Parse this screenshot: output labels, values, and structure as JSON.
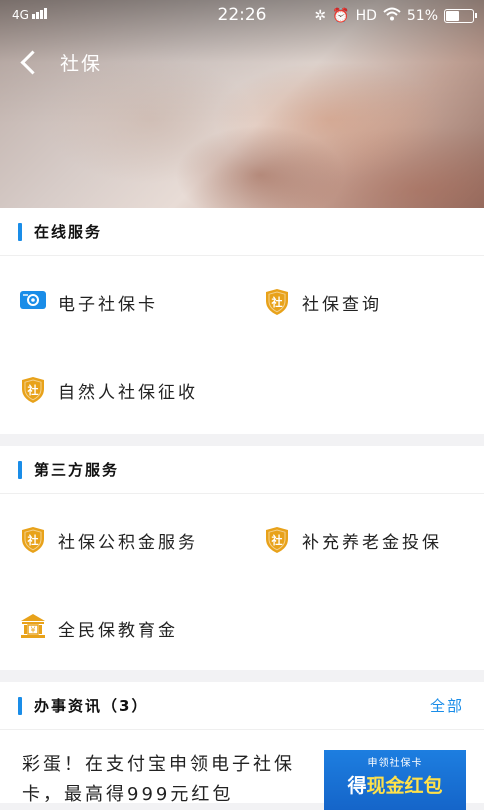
{
  "status": {
    "network": "4G",
    "time": "22:26",
    "hd": "HD",
    "battery": "51%",
    "battery_level": 0.51
  },
  "nav": {
    "title": "社保"
  },
  "online": {
    "title": "在线服务",
    "items": [
      {
        "label": "电子社保卡",
        "icon": "card-icon"
      },
      {
        "label": "社保查询",
        "icon": "shield-icon"
      },
      {
        "label": "自然人社保征收",
        "icon": "shield-icon"
      }
    ]
  },
  "third": {
    "title": "第三方服务",
    "items": [
      {
        "label": "社保公积金服务",
        "icon": "shield-icon"
      },
      {
        "label": "补充养老金投保",
        "icon": "shield-icon"
      },
      {
        "label": "全民保教育金",
        "icon": "bank-icon"
      }
    ]
  },
  "icon_glyph": "社",
  "news": {
    "title": "办事资讯（3）",
    "more": "全部",
    "article": {
      "text": "彩蛋！在支付宝申领电子社保卡，最高得999元红包",
      "banner_line1": "申领社保卡",
      "banner_line2_a": "得",
      "banner_line2_b": "现金红包"
    }
  },
  "colors": {
    "accent": "#1a8de8",
    "icon_gold": "#e8a21a",
    "card_blue": "#1a8de8"
  }
}
